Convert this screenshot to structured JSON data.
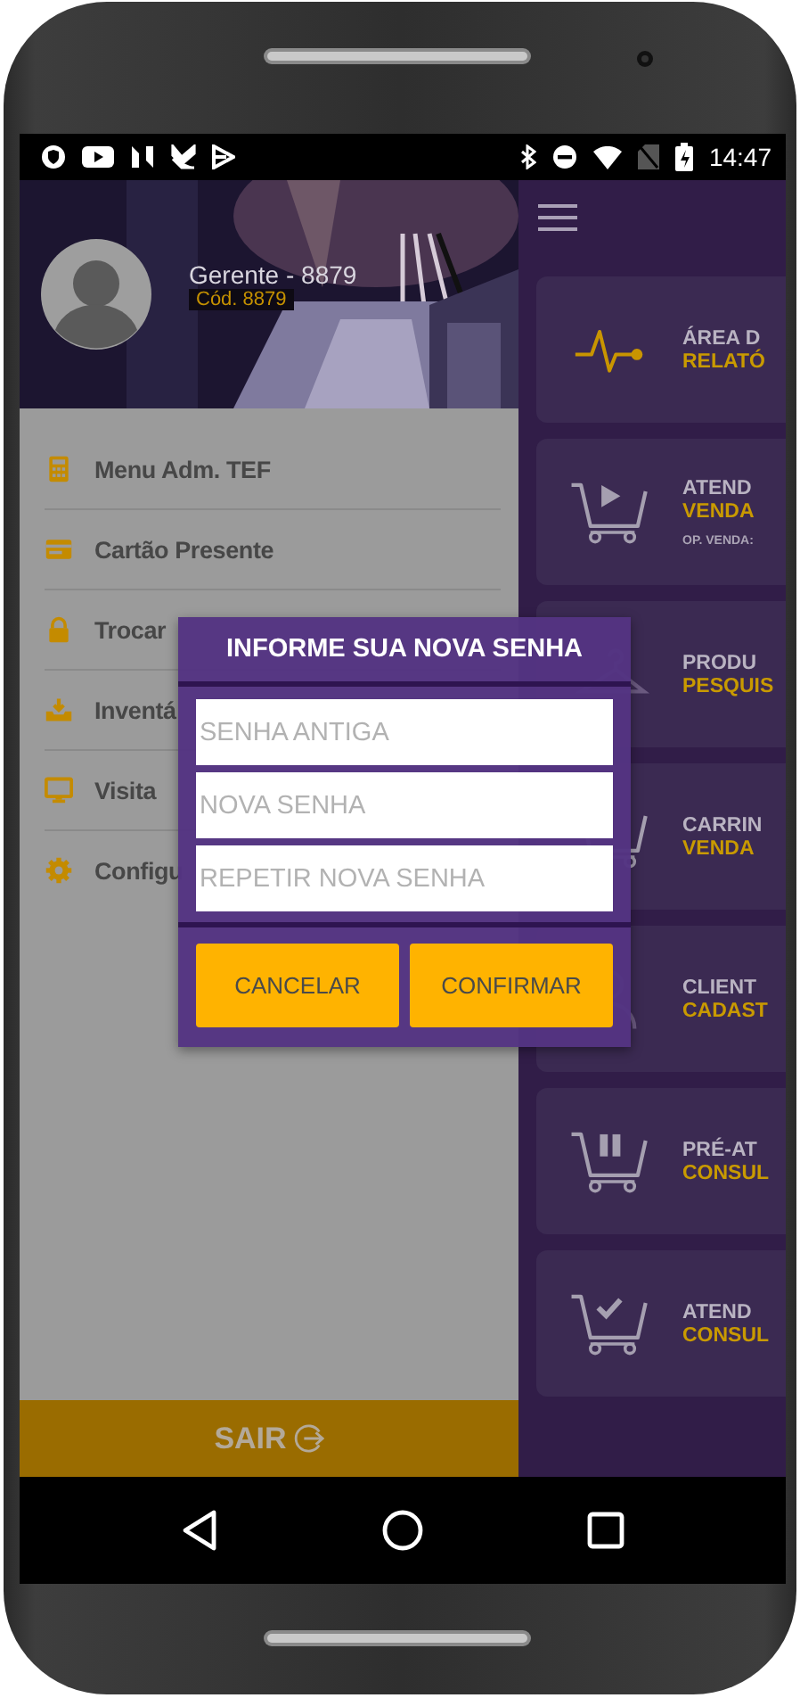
{
  "status_bar": {
    "time": "14:47"
  },
  "drawer": {
    "profile": {
      "name": "Gerente - 8879",
      "code": "Cód. 8879"
    },
    "items": [
      {
        "label": "Menu Adm. TEF"
      },
      {
        "label": "Cartão Presente"
      },
      {
        "label": "Trocar"
      },
      {
        "label": "Inventá"
      },
      {
        "label": "Visita"
      },
      {
        "label": "Configu"
      }
    ],
    "logout": "SAIR"
  },
  "main": {
    "cards": [
      {
        "title": "ÁREA D",
        "subtitle": "RELATÓ"
      },
      {
        "title": "ATEND",
        "subtitle": "VENDA",
        "note": "OP. VENDA:"
      },
      {
        "title": "PRODU",
        "subtitle": "PESQUIS"
      },
      {
        "title": "CARRIN",
        "subtitle": "VENDA"
      },
      {
        "title": "CLIENT",
        "subtitle": "CADAST"
      },
      {
        "title": "PRÉ-AT",
        "subtitle": "CONSUL"
      },
      {
        "title": "ATEND",
        "subtitle": "CONSUL"
      }
    ]
  },
  "dialog": {
    "title": "INFORME SUA NOVA SENHA",
    "fields": [
      {
        "placeholder": "SENHA ANTIGA"
      },
      {
        "placeholder": "NOVA SENHA"
      },
      {
        "placeholder": "REPETIR NOVA SENHA"
      }
    ],
    "buttons": [
      "CANCELAR",
      "CONFIRMAR"
    ]
  }
}
